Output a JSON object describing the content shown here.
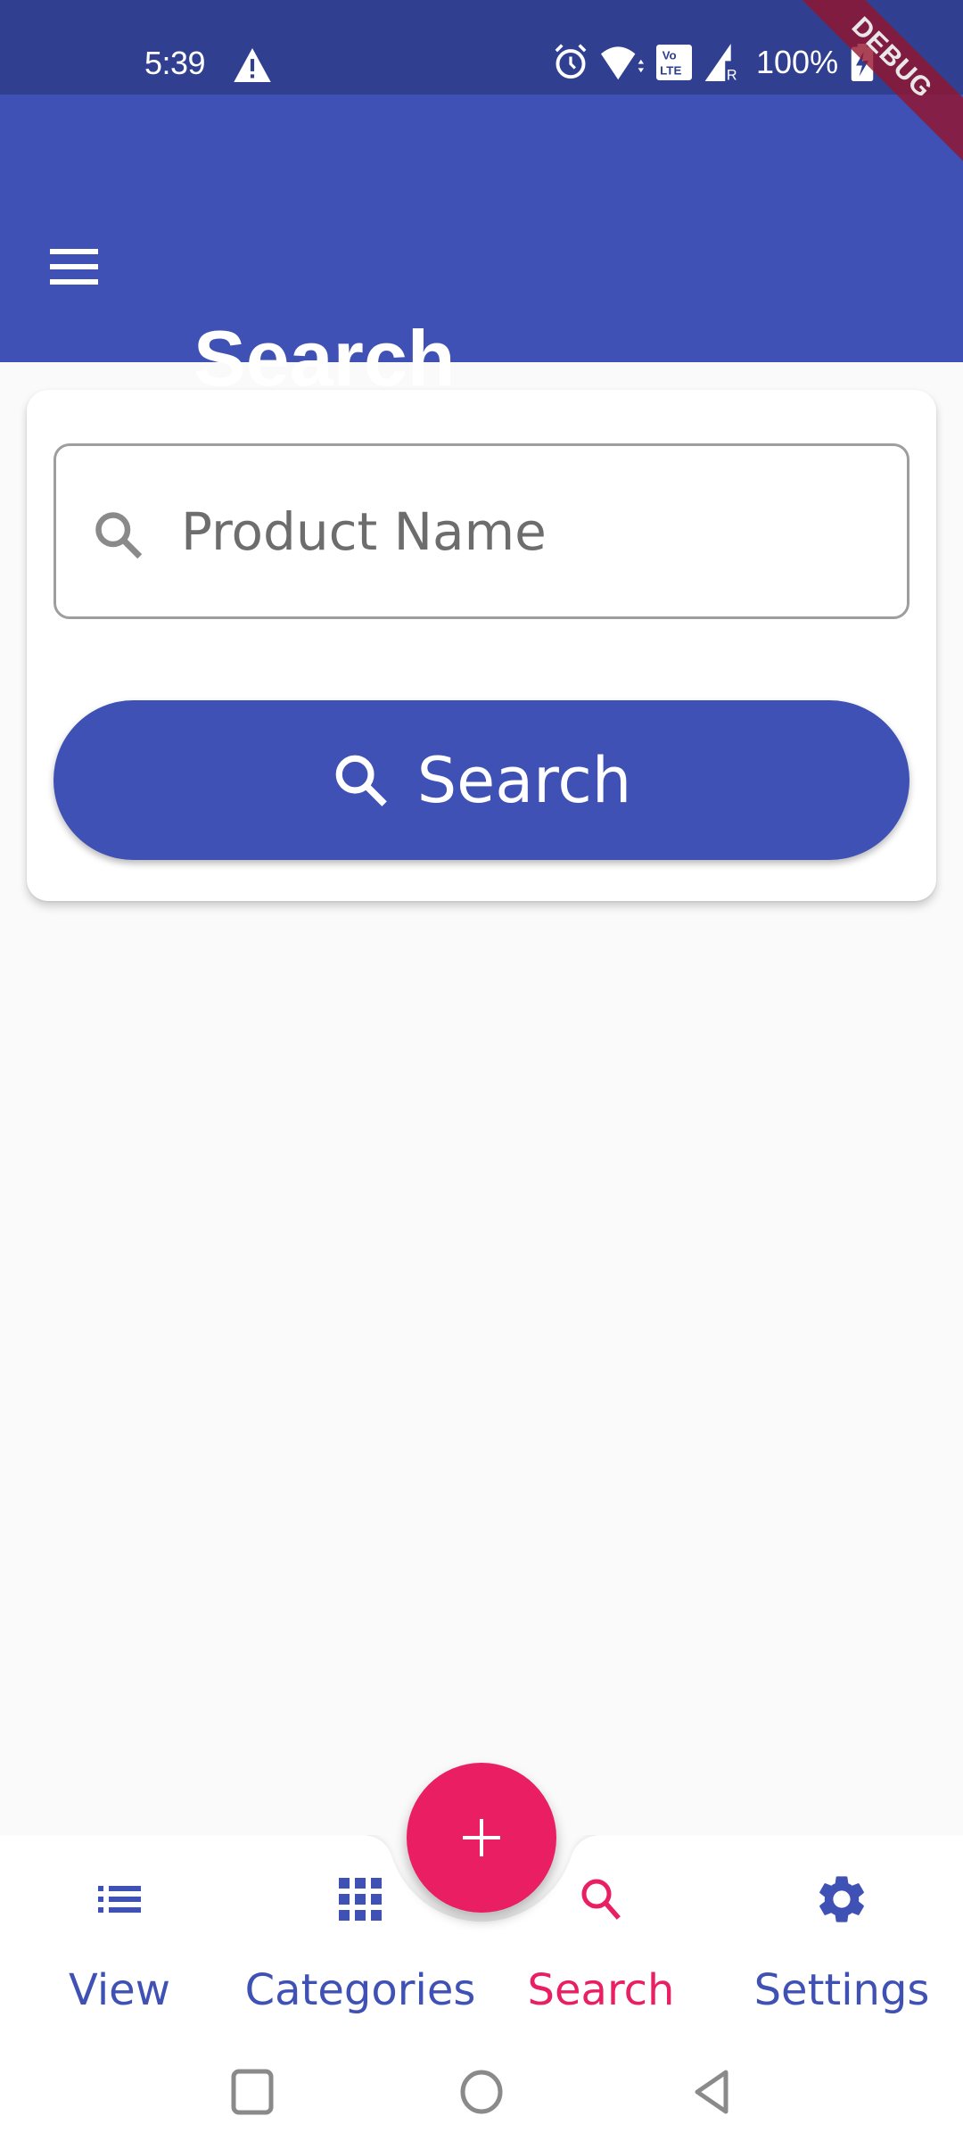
{
  "status_bar": {
    "time": "5:39",
    "battery": "100%",
    "icons": [
      "warning-icon",
      "alarm-icon",
      "wifi-icon",
      "volte-icon",
      "signal-roaming-icon",
      "battery-charging-icon"
    ]
  },
  "debug_banner": "DEBUG",
  "app_bar": {
    "title": "Search",
    "menu_icon": "menu-icon"
  },
  "search_card": {
    "input": {
      "placeholder": "Product Name",
      "value": "",
      "icon": "search-icon"
    },
    "button": {
      "label": "Search",
      "icon": "search-icon"
    }
  },
  "fab": {
    "icon": "add-icon",
    "label": "+"
  },
  "bottom_nav": {
    "items": [
      {
        "label": "View",
        "icon": "list-icon",
        "active": false
      },
      {
        "label": "Categories",
        "icon": "grid-icon",
        "active": false
      },
      {
        "label": "Search",
        "icon": "search-icon",
        "active": true
      },
      {
        "label": "Settings",
        "icon": "gear-icon",
        "active": false
      }
    ]
  },
  "colors": {
    "primary": "#3f51b5",
    "status_bar": "#303f8f",
    "accent": "#e91e63",
    "background": "#fafafa"
  },
  "system_nav": {
    "buttons": [
      "recents-icon",
      "home-icon",
      "back-icon"
    ]
  }
}
